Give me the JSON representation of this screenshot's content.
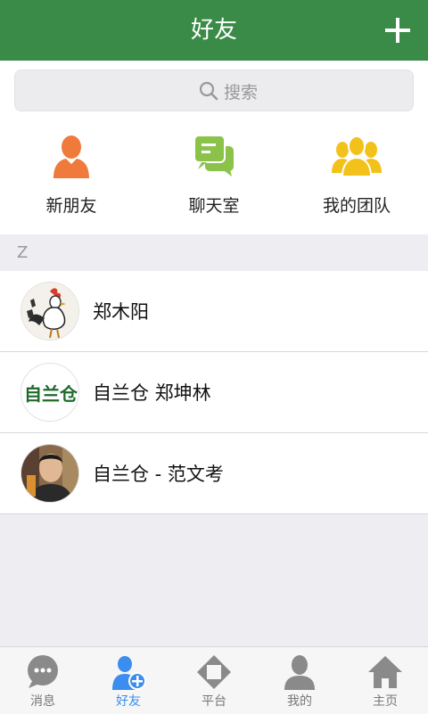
{
  "header": {
    "title": "好友"
  },
  "search": {
    "placeholder": "搜索"
  },
  "quick_actions": [
    {
      "label": "新朋友",
      "icon": "person-icon",
      "color": "#f07a3c"
    },
    {
      "label": "聊天室",
      "icon": "chat-icon",
      "color": "#8bc34a"
    },
    {
      "label": "我的团队",
      "icon": "group-icon",
      "color": "#f3c21a"
    }
  ],
  "section_letter": "Z",
  "contacts": [
    {
      "name": "郑木阳",
      "avatar": "rooster-painting"
    },
    {
      "name": "自兰仓 郑坤林",
      "avatar": "logo-text",
      "logo_text": "自兰仓"
    },
    {
      "name": "自兰仓 - 范文考",
      "avatar": "photo-man"
    }
  ],
  "tabs": [
    {
      "label": "消息",
      "icon": "message-icon",
      "active": false
    },
    {
      "label": "好友",
      "icon": "friends-icon",
      "active": true
    },
    {
      "label": "平台",
      "icon": "platform-icon",
      "active": false
    },
    {
      "label": "我的",
      "icon": "profile-icon",
      "active": false
    },
    {
      "label": "主页",
      "icon": "home-icon",
      "active": false
    }
  ],
  "colors": {
    "header": "#3a8a48",
    "accent": "#3c8df0",
    "logo_green": "#1d6b2a"
  }
}
